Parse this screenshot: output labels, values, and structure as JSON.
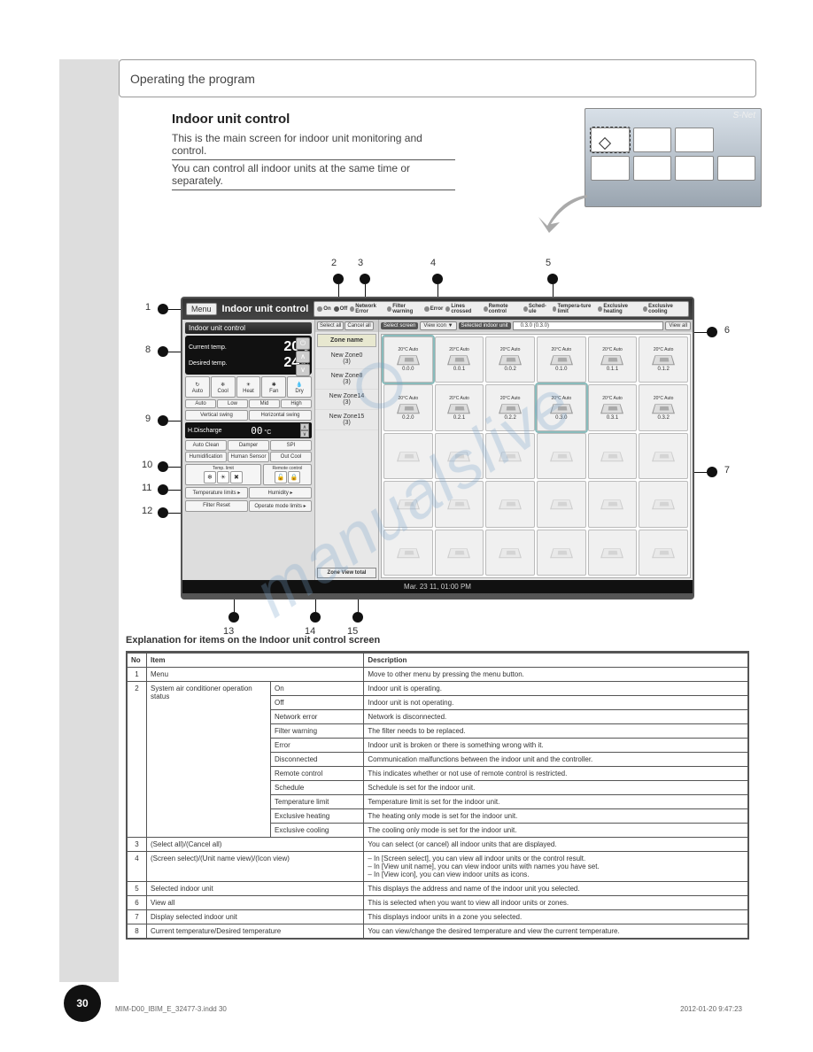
{
  "page": {
    "header": "Operating the program",
    "page_number": "30",
    "footer_left": "MIM-D00_IBIM_E_32477-3.indd   30",
    "footer_right": "2012-01-20   9:47:23"
  },
  "section": {
    "title": "Indoor unit control",
    "intro1": "This is the main screen for indoor unit monitoring and control.",
    "intro2": "You can control all indoor units at the same time or separately."
  },
  "inset": {
    "brand": "S-Net"
  },
  "screenshot": {
    "menu": "Menu",
    "title": "Indoor unit control",
    "status": [
      "On",
      "Off",
      "Network Error",
      "Filter warning",
      "Error",
      "Lines crossed",
      "Remote control",
      "Sched-ule",
      "Tempera-ture limit",
      "Exclusive heating",
      "Exclusive cooling"
    ],
    "left": {
      "header": "Indoor unit control",
      "current_lbl": "Current temp.",
      "current_val": "20",
      "unit": "°C",
      "desired_lbl": "Desired temp.",
      "desired_val": "24",
      "modes": [
        "Auto",
        "Cool",
        "Heat",
        "Fan",
        "Dry"
      ],
      "fan": [
        "Auto",
        "Low",
        "Mid",
        "High"
      ],
      "swing": [
        "Vertical swing",
        "Horizontal swing"
      ],
      "hd_lbl": "H.Discharge",
      "hd_val": "00",
      "hd_unit": "°C",
      "opts": [
        "Auto Clean",
        "Damper",
        "SPI",
        "Humidification",
        "Human Sensor",
        "Out Cool"
      ],
      "tl_lbl": "Temp. limit",
      "rc_lbl": "Remote control",
      "bottom_links": [
        "Temperature limits ▸",
        "Humidity ▸",
        "Filter Reset",
        "Operate mode limits ▸"
      ]
    },
    "mid": {
      "buttons": [
        "Select all",
        "Cancel all"
      ],
      "zone_hdr": "Zone name",
      "zones": [
        {
          "n": "New Zone0",
          "c": "(3)"
        },
        {
          "n": "New Zone8",
          "c": "(3)"
        },
        {
          "n": "New Zone14",
          "c": "(3)"
        },
        {
          "n": "New Zone15",
          "c": "(3)"
        }
      ],
      "zone_view": "Zone View total"
    },
    "right": {
      "view_icon": "View icon",
      "select_screen": "Select screen",
      "selected_lbl": "Selected indoor unit",
      "selected_val": "0.3.0 (0.3.0)",
      "view_all": "View all",
      "units_row1": [
        {
          "s": "20°C Auto",
          "a": "0.0.0",
          "sel": true
        },
        {
          "s": "20°C Auto",
          "a": "0.0.1"
        },
        {
          "s": "20°C Auto",
          "a": "0.0.2"
        },
        {
          "s": "20°C Auto",
          "a": "0.1.0"
        },
        {
          "s": "20°C Auto",
          "a": "0.1.1"
        },
        {
          "s": "20°C Auto",
          "a": "0.1.2"
        }
      ],
      "units_row2": [
        {
          "s": "20°C Auto",
          "a": "0.2.0"
        },
        {
          "s": "20°C Auto",
          "a": "0.2.1"
        },
        {
          "s": "20°C Auto",
          "a": "0.2.2"
        },
        {
          "s": "20°C Auto",
          "a": "0.3.0",
          "sel": true
        },
        {
          "s": "20°C Auto",
          "a": "0.3.1"
        },
        {
          "s": "20°C Auto",
          "a": "0.3.2"
        }
      ]
    },
    "footer": "Mar. 23 11, 01:00 PM"
  },
  "callouts": {
    "c1": "1",
    "c2": "2",
    "c3": "3",
    "c4": "4",
    "c5": "5",
    "c6": "6",
    "c7": "7",
    "c8": "8",
    "c9": "9",
    "c10": "10",
    "c11": "11",
    "c12": "12",
    "c13": "13",
    "c14": "14",
    "c15": "15"
  },
  "explain_intro": "Explanation for items on the Indoor unit control screen",
  "table": {
    "headers": [
      "No",
      "Item",
      "Description"
    ],
    "rows": [
      {
        "no": "1",
        "item": "Menu",
        "desc": "Move to other menu by pressing the menu button."
      },
      {
        "no": "",
        "item": "",
        "sub": "On",
        "desc": "Indoor unit is operating."
      },
      {
        "no": "",
        "item": "",
        "sub": "Off",
        "desc": "Indoor unit is not operating."
      },
      {
        "no": "",
        "item": "",
        "sub": "Network error",
        "desc": "Network is disconnected."
      },
      {
        "no": "",
        "item": "",
        "sub": "Filter warning",
        "desc": "The filter needs to be replaced."
      },
      {
        "no": "2",
        "item": "System air conditioner operation status",
        "sub": "Error",
        "desc": "Indoor unit is broken or there is something wrong with it."
      },
      {
        "no": "",
        "item": "",
        "sub": "Disconnected",
        "desc": "Communication malfunctions between the indoor unit and the controller."
      },
      {
        "no": "",
        "item": "",
        "sub": "Remote control",
        "desc": "This indicates whether or not use of remote control is restricted."
      },
      {
        "no": "",
        "item": "",
        "sub": "Schedule",
        "desc": "Schedule is set for the indoor unit."
      },
      {
        "no": "",
        "item": "",
        "sub": "Temperature limit",
        "desc": "Temperature limit is set for the indoor unit."
      },
      {
        "no": "",
        "item": "",
        "sub": "Exclusive heating",
        "desc": "The heating only mode is set for the indoor unit."
      },
      {
        "no": "",
        "item": "",
        "sub": "Exclusive cooling",
        "desc": "The cooling only mode is set for the indoor unit."
      },
      {
        "no": "3",
        "item": "(Select all)/(Cancel all)",
        "desc": "You can select (or cancel) all indoor units that are displayed."
      },
      {
        "no": "4",
        "item": "(Screen select)/(Unit name view)/(Icon view)",
        "desc": "– In [Screen select], you can view all indoor units or the control result.\n– In [View unit name], you can view indoor units with names you have set.\n– In [View icon], you can view indoor units as icons."
      },
      {
        "no": "5",
        "item": "Selected indoor unit",
        "desc": "This displays the address and name of the indoor unit you selected."
      },
      {
        "no": "6",
        "item": "View all",
        "desc": "This is selected when you want to view all indoor units or zones."
      },
      {
        "no": "7",
        "item": "Display selected indoor unit",
        "desc": "This displays indoor units in a zone you selected."
      },
      {
        "no": "8",
        "item": "Current temperature/Desired temperature",
        "desc": "You can view/change the desired temperature and view the current temperature."
      }
    ]
  }
}
